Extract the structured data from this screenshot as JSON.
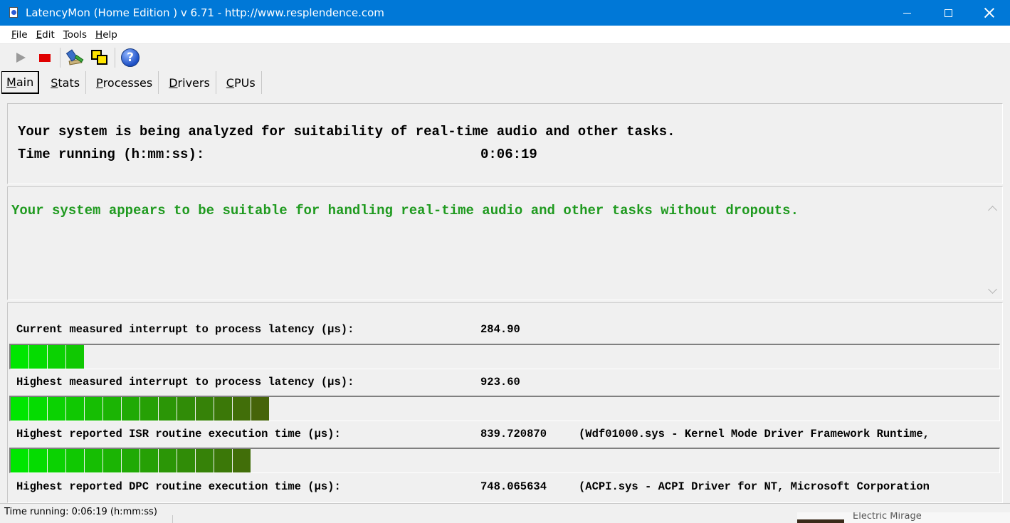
{
  "window": {
    "title": "LatencyMon  (Home Edition )  v 6.71 - http://www.resplendence.com"
  },
  "menu": [
    {
      "label": "File",
      "key": "F",
      "rest": "ile"
    },
    {
      "label": "Edit",
      "key": "E",
      "rest": "dit"
    },
    {
      "label": "Tools",
      "key": "T",
      "rest": "ools"
    },
    {
      "label": "Help",
      "key": "H",
      "rest": "elp"
    }
  ],
  "toolbar": {
    "icons": [
      "play-icon",
      "stop-icon",
      "tools-icon",
      "windows-icon",
      "help-icon"
    ],
    "stop_color": "#e00000"
  },
  "tabs": [
    {
      "label": "Main",
      "key": "M",
      "rest": "ain",
      "active": true
    },
    {
      "label": "Stats",
      "key": "S",
      "rest": "tats",
      "active": false
    },
    {
      "label": "Processes",
      "key": "P",
      "rest": "rocesses",
      "active": false
    },
    {
      "label": "Drivers",
      "key": "D",
      "rest": "rivers",
      "active": false
    },
    {
      "label": "CPUs",
      "key": "C",
      "rest": "PUs",
      "active": false
    }
  ],
  "analysis": {
    "line1": "Your system is being analyzed for suitability of real-time audio and other tasks.",
    "time_label": "Time running (h:mm:ss):",
    "time_value": "0:06:19"
  },
  "verdict": {
    "text": "Your system appears to be suitable for handling real-time audio and other tasks without dropouts.",
    "color": "#1f9a1f"
  },
  "metrics": [
    {
      "label": "Current measured interrupt to process latency (µs):",
      "value": "284.90",
      "extra": "",
      "bar_segments": 4
    },
    {
      "label": "Highest measured interrupt to process latency (µs):",
      "value": "923.60",
      "extra": "",
      "bar_segments": 14
    },
    {
      "label": "Highest reported ISR routine execution time (µs):",
      "value": "839.720870",
      "extra": "(Wdf01000.sys - Kernel Mode Driver Framework Runtime,",
      "bar_segments": 13
    },
    {
      "label": "Highest reported DPC routine execution time (µs):",
      "value": "748.065634",
      "extra": "(ACPI.sys - ACPI Driver for NT, Microsoft Corporation",
      "bar_segments": null
    }
  ],
  "statusbar": {
    "text": "Time running: 0:06:19  (h:mm:ss)"
  },
  "background_window": {
    "text": "Electric Mirage"
  }
}
